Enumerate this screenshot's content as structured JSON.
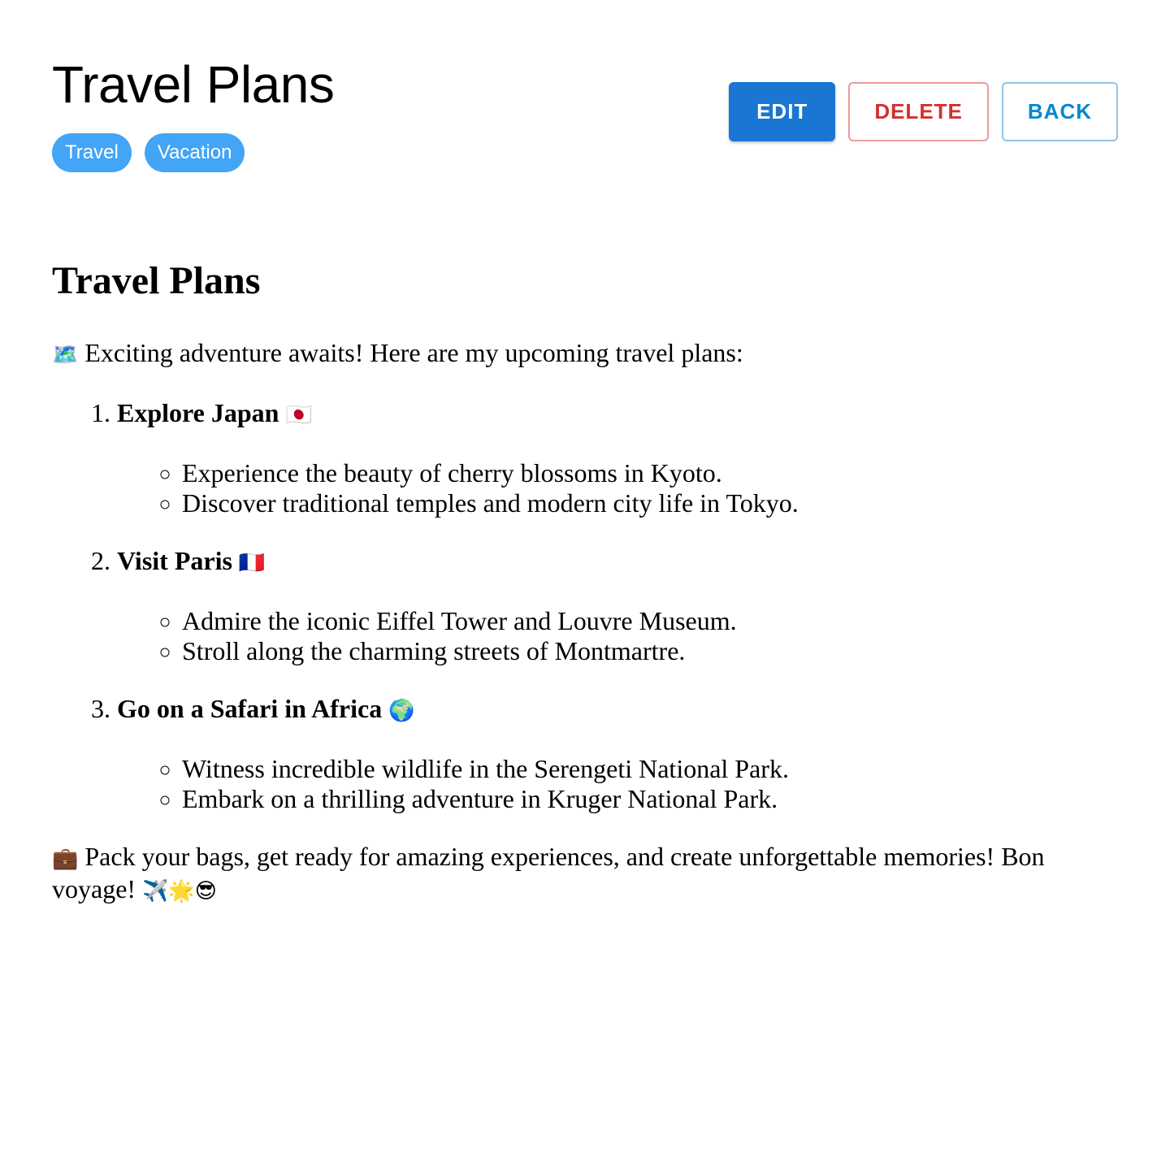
{
  "header": {
    "title": "Travel Plans",
    "tags": [
      "Travel",
      "Vacation"
    ],
    "actions": {
      "edit_label": "EDIT",
      "delete_label": "DELETE",
      "back_label": "BACK"
    }
  },
  "content": {
    "heading": "Travel Plans",
    "intro_icon": "🗺️",
    "intro_text": "Exciting adventure awaits! Here are my upcoming travel plans:",
    "plans": [
      {
        "title": "Explore Japan",
        "icon": "🇯🇵",
        "details": [
          "Experience the beauty of cherry blossoms in Kyoto.",
          "Discover traditional temples and modern city life in Tokyo."
        ]
      },
      {
        "title": "Visit Paris",
        "icon": "🇫🇷",
        "details": [
          "Admire the iconic Eiffel Tower and Louvre Museum.",
          "Stroll along the charming streets of Montmartre."
        ]
      },
      {
        "title": "Go on a Safari in Africa",
        "icon": "🌍",
        "details": [
          "Witness incredible wildlife in the Serengeti National Park.",
          "Embark on a thrilling adventure in Kruger National Park."
        ]
      }
    ],
    "outro_icon": "💼",
    "outro_text": "Pack your bags, get ready for amazing experiences, and create unforgettable memories! Bon voyage!",
    "outro_trailing_icons": "✈️🌟😎"
  },
  "colors": {
    "tag_background": "#42a5f5",
    "edit_button": "#1976d2",
    "delete_button": "#d32f2f",
    "back_button": "#0288d1"
  }
}
